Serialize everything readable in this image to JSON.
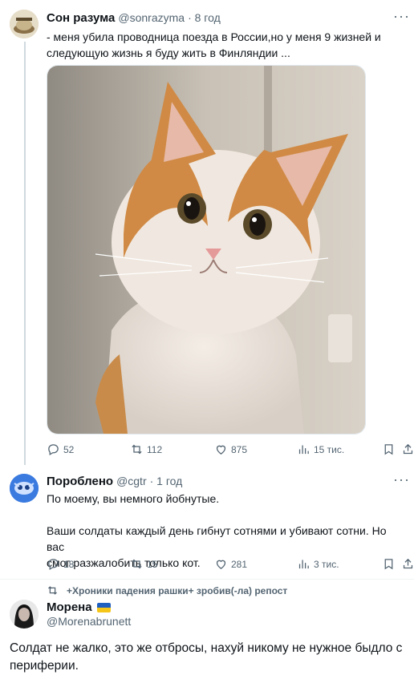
{
  "tweet1": {
    "author_name": "Сон разума",
    "author_handle": "@sonrazyma",
    "time": "· 8 год",
    "text_line1": "- меня убила проводница поезда в России,но у меня 9 жизней и",
    "text_line2": "следующую жизнь я буду жить в Финляндии  ...",
    "media_description_icon": "cat-photo",
    "stats": {
      "replies": "52",
      "retweets": "112",
      "likes": "875",
      "views": "15 тис."
    }
  },
  "tweet2": {
    "author_name": "Пороблено",
    "author_handle": "@cgtr",
    "time": "· 1 год",
    "text_line1": "По моему, вы немного йобнутые.",
    "text_line2": "Ваши солдаты каждый день гибнут сотнями и убивают сотни. Но вас",
    "text_line3": "смог разжалобить только кот.",
    "stats": {
      "replies": "18",
      "retweets": "15",
      "likes": "281",
      "views": "3 тис."
    }
  },
  "repost": {
    "text": "+Хроники падения рашки+ зробив(-ла) репост"
  },
  "tweet3": {
    "author_name": "Морена",
    "author_handle": "@Morenabrunett",
    "text_line1": "Солдат не жалко, это же отбросы, нахуй никому не нужное быдло с",
    "text_line2": "периферии."
  },
  "colors": {
    "flag_blue": "#1f5fbf",
    "flag_yellow": "#f5c518",
    "muted": "#536471"
  }
}
